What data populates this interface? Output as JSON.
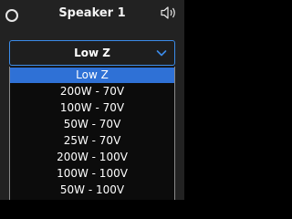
{
  "header": {
    "title": "Speaker 1",
    "power_icon": "power-ring-icon",
    "volume_icon": "speaker-volume-icon"
  },
  "impedance_select": {
    "value": "Low Z",
    "options": [
      "Low Z",
      "200W - 70V",
      "100W - 70V",
      "50W - 70V",
      "25W - 70V",
      "200W - 100V",
      "100W - 100V",
      "50W - 100V"
    ],
    "selected_index": 0
  },
  "colors": {
    "accent": "#2f71d6",
    "border": "#3b8be8",
    "background": "#222222"
  }
}
